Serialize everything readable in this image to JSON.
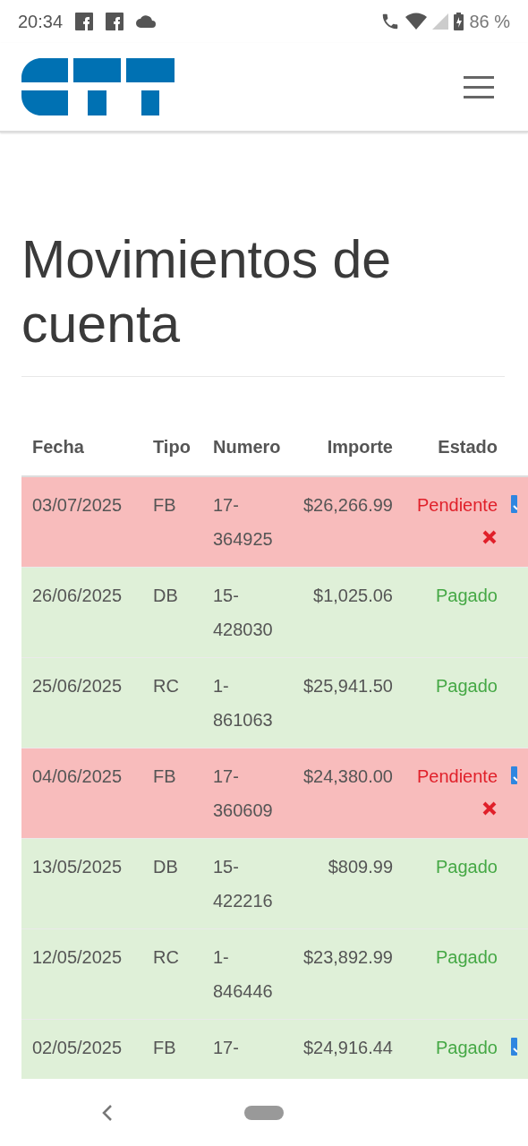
{
  "status_bar": {
    "time": "20:34",
    "battery": "86 %"
  },
  "title": "Movimientos de cuenta",
  "table": {
    "columns": [
      "Fecha",
      "Tipo",
      "Numero",
      "Importe",
      "Estado"
    ],
    "rows": [
      {
        "date": "03/07/2025",
        "type": "FB",
        "number": "17-364925",
        "amount": "$26,266.99",
        "status": "Pendiente",
        "kind": "pending",
        "download": true
      },
      {
        "date": "26/06/2025",
        "type": "DB",
        "number": "15-428030",
        "amount": "$1,025.06",
        "status": "Pagado",
        "kind": "paid",
        "download": false
      },
      {
        "date": "25/06/2025",
        "type": "RC",
        "number": "1-861063",
        "amount": "$25,941.50",
        "status": "Pagado",
        "kind": "paid",
        "download": false
      },
      {
        "date": "04/06/2025",
        "type": "FB",
        "number": "17-360609",
        "amount": "$24,380.00",
        "status": "Pendiente",
        "kind": "pending",
        "download": true
      },
      {
        "date": "13/05/2025",
        "type": "DB",
        "number": "15-422216",
        "amount": "$809.99",
        "status": "Pagado",
        "kind": "paid",
        "download": false
      },
      {
        "date": "12/05/2025",
        "type": "RC",
        "number": "1-846446",
        "amount": "$23,892.99",
        "status": "Pagado",
        "kind": "paid",
        "download": false
      },
      {
        "date": "02/05/2025",
        "type": "FB",
        "number": "17-",
        "amount": "$24,916.44",
        "status": "Pagado",
        "kind": "paid",
        "download": true
      }
    ]
  }
}
